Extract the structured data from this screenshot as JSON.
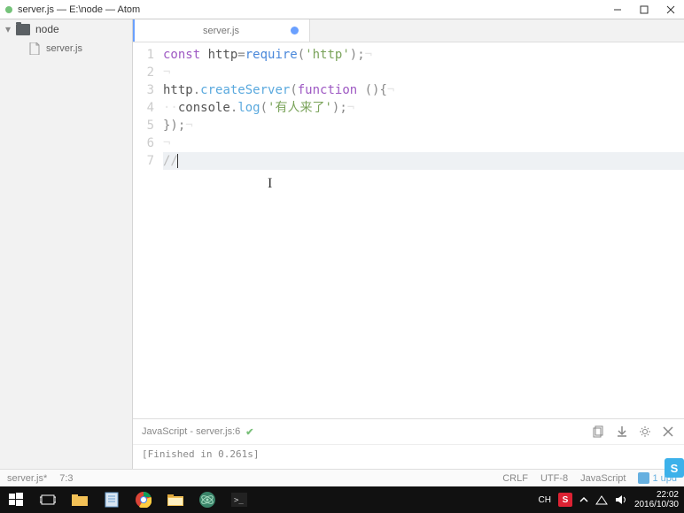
{
  "window": {
    "title": "server.js — E:\\node — Atom"
  },
  "sidebar": {
    "root": "node",
    "file": "server.js"
  },
  "tab": {
    "label": "server.js"
  },
  "gutter": [
    "1",
    "2",
    "3",
    "4",
    "5",
    "6",
    "7"
  ],
  "code": {
    "l1_kw": "const ",
    "l1_var": "http",
    "l1_eq": "=",
    "l1_fn": "require",
    "l1_po": "(",
    "l1_str": "'http'",
    "l1_pc": ")",
    "l1_semi": ";",
    "l3_obj": "http",
    "l3_dot": ".",
    "l3_fn": "createServer",
    "l3_po": "(",
    "l3_kw": "function ",
    "l3_p2": "()",
    "l3_brace": "{",
    "l4_indent": "  ",
    "l4_obj": "console",
    "l4_dot": ".",
    "l4_fn": "log",
    "l4_po": "(",
    "l4_str": "'有人来了'",
    "l4_pc": ")",
    "l4_semi": ";",
    "l5_close": "});",
    "l7_comment": "//"
  },
  "editor_bottom": {
    "lang_file": "JavaScript - server.js:6",
    "finished": "[Finished in 0.261s]"
  },
  "statusbar": {
    "file": "server.js*",
    "pos": "7:3",
    "crlf": "CRLF",
    "enc": "UTF-8",
    "lang": "JavaScript",
    "upd": "1 upd"
  },
  "tray": {
    "ime": "CH",
    "s_label": "S",
    "time": "22:02",
    "date": "2016/10/30"
  },
  "floating_s": "S"
}
